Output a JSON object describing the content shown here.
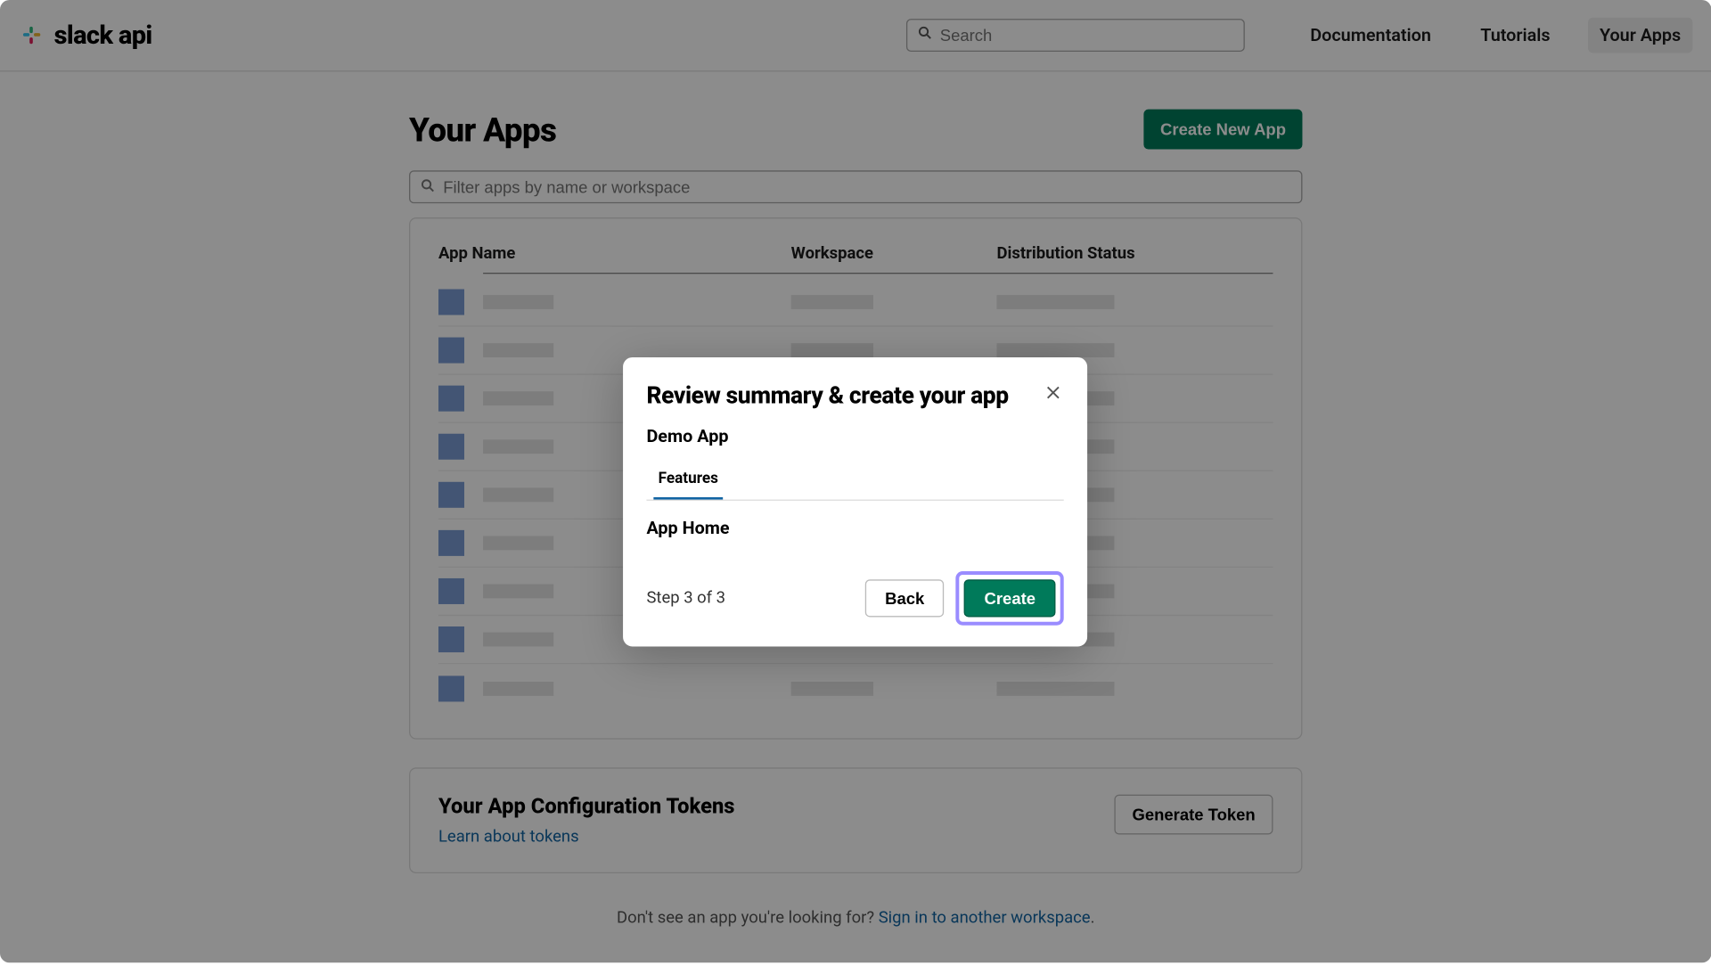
{
  "brand": {
    "name": "slack api"
  },
  "topbar": {
    "search_placeholder": "Search",
    "links": {
      "documentation": "Documentation",
      "tutorials": "Tutorials",
      "your_apps": "Your Apps"
    }
  },
  "page": {
    "title": "Your Apps",
    "create_button": "Create New App",
    "filter_placeholder": "Filter apps by name or workspace",
    "table_headers": {
      "name": "App Name",
      "workspace": "Workspace",
      "status": "Distribution Status"
    }
  },
  "tokens": {
    "title": "Your App Configuration Tokens",
    "learn_link": "Learn about tokens",
    "generate_button": "Generate Token"
  },
  "footer": {
    "prefix": "Don't see an app you're looking for? ",
    "link": "Sign in to another workspace",
    "suffix": "."
  },
  "modal": {
    "title": "Review summary & create your app",
    "app_name": "Demo App",
    "tab_label": "Features",
    "feature": "App Home",
    "step_text": "Step 3 of 3",
    "back_label": "Back",
    "create_label": "Create"
  }
}
